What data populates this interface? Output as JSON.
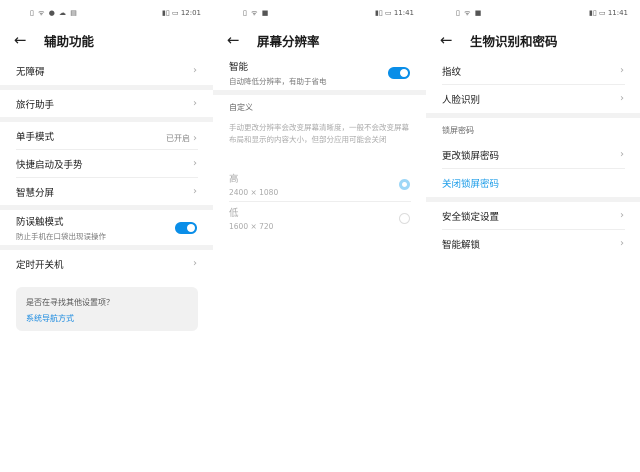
{
  "panel1": {
    "status": {
      "left_icons": "▯ ᯤ ● ☁ ▤",
      "right": "▮▯ ▭ 12:01"
    },
    "title": "辅助功能",
    "items": [
      {
        "label": "无障碍"
      },
      {
        "label": "旅行助手"
      },
      {
        "label": "单手模式",
        "value": "已开启"
      },
      {
        "label": "快捷启动及手势"
      },
      {
        "label": "智慧分屏"
      },
      {
        "label": "防误触模式",
        "sub": "防止手机在口袋出现误操作",
        "toggle": true
      },
      {
        "label": "定时开关机"
      }
    ],
    "card": {
      "question": "是否在寻找其他设置项？",
      "link": "系统导航方式"
    }
  },
  "panel2": {
    "status": {
      "left_icons": "▯ ᯤ ■",
      "right": "▮▯ ▭ 11:41"
    },
    "title": "屏幕分辨率",
    "smart": {
      "label": "智能",
      "sub": "自动降低分辨率，有助于省电",
      "toggle": true
    },
    "custom_label": "自定义",
    "description": "手动更改分辨率会改变屏幕清晰度，一般不会改变屏幕布局和显示的内容大小，但部分应用可能会关闭",
    "options": [
      {
        "label": "高",
        "res": "2400 × 1080",
        "selected": true
      },
      {
        "label": "低",
        "res": "1600 × 720",
        "selected": false
      }
    ]
  },
  "panel3": {
    "status": {
      "left_icons": "▯ ᯤ ■",
      "right": "▮▯ ▭ 11:41"
    },
    "title": "生物识别和密码",
    "items": [
      {
        "label": "指纹"
      },
      {
        "label": "人脸识别"
      },
      {
        "label": "锁屏密码"
      },
      {
        "label": "更改锁屏密码"
      },
      {
        "label": "关闭锁屏密码"
      },
      {
        "label": "安全锁定设置"
      },
      {
        "label": "智能解锁"
      }
    ]
  },
  "colors": {
    "accent": "#0a8ee8",
    "link": "#1a9be8"
  }
}
